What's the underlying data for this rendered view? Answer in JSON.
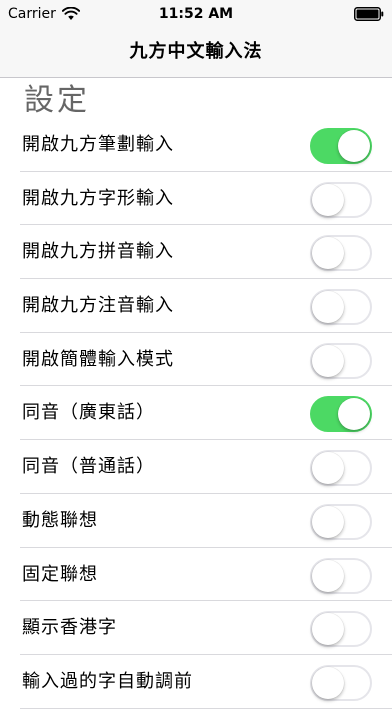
{
  "status_bar": {
    "carrier": "Carrier",
    "time": "11:52 AM"
  },
  "nav": {
    "title": "九方中文輸入法"
  },
  "section": {
    "title": "設定"
  },
  "settings": [
    {
      "label": "開啟九方筆劃輸入",
      "on": true
    },
    {
      "label": "開啟九方字形輸入",
      "on": false
    },
    {
      "label": "開啟九方拼音輸入",
      "on": false
    },
    {
      "label": "開啟九方注音輸入",
      "on": false
    },
    {
      "label": "開啟簡體輸入模式",
      "on": false
    },
    {
      "label": "同音（廣東話）",
      "on": true
    },
    {
      "label": "同音（普通話）",
      "on": false
    },
    {
      "label": "動態聯想",
      "on": false
    },
    {
      "label": "固定聯想",
      "on": false
    },
    {
      "label": "顯示香港字",
      "on": false
    },
    {
      "label": "輸入過的字自動調前",
      "on": false
    }
  ],
  "colors": {
    "toggle_on": "#4cd964",
    "toggle_off_border": "#e5e5ea",
    "section_title": "#666666"
  },
  "icons": {
    "wifi": "wifi-icon",
    "battery": "battery-icon"
  }
}
